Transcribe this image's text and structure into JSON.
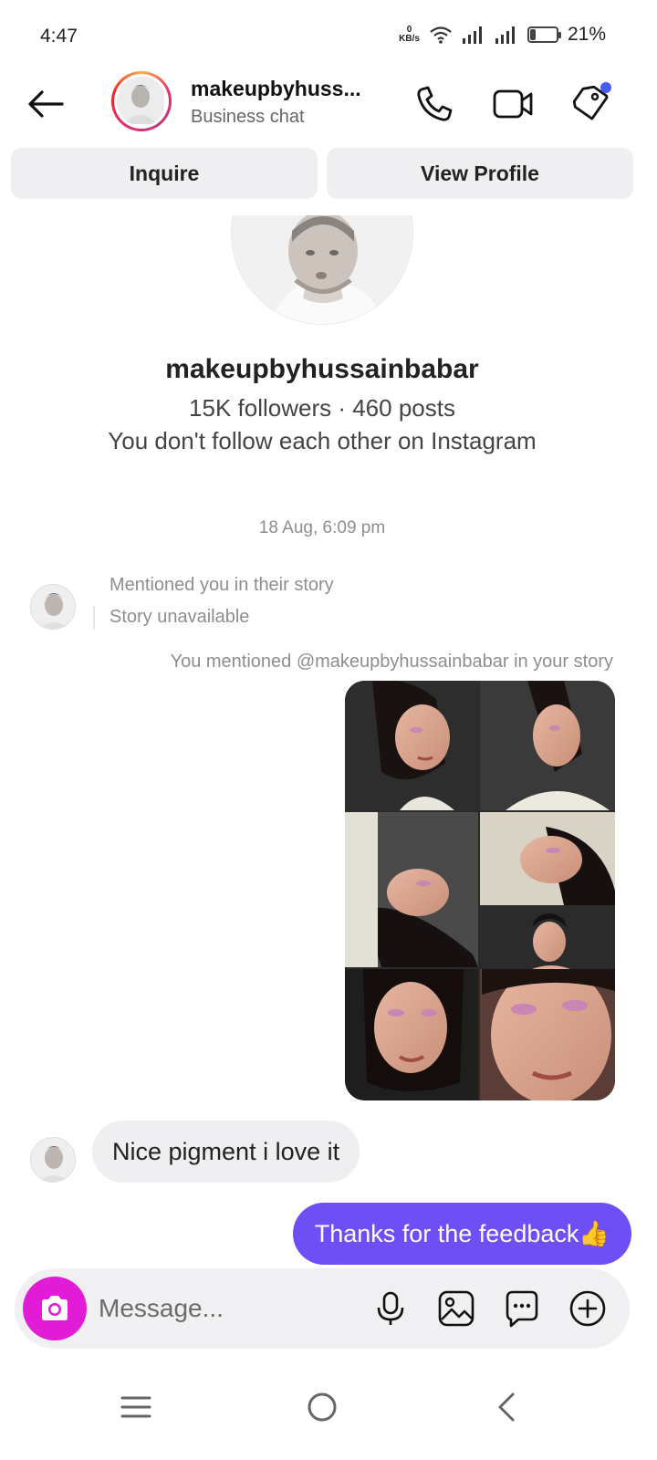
{
  "status_bar": {
    "time": "4:47",
    "net_speed_value": "0",
    "net_speed_unit": "KB/s",
    "battery_percent": "21%",
    "battery_level": 0.21
  },
  "header": {
    "name": "makeupbyhuss...",
    "subtitle": "Business chat",
    "icons": [
      "back-arrow-icon",
      "phone-icon",
      "video-camera-icon",
      "tag-icon"
    ]
  },
  "actions": {
    "inquire_label": "Inquire",
    "view_profile_label": "View Profile"
  },
  "profile": {
    "username": "makeupbyhussainbabar",
    "stats": "15K followers · 460 posts",
    "follow_status": "You don't follow each other on Instagram"
  },
  "conversation": {
    "timestamp": "18 Aug, 6:09 pm",
    "mention_received_line1": "Mentioned you in their story",
    "mention_received_line2": "Story unavailable",
    "mention_sent": "You mentioned @makeupbyhussainbabar in your story",
    "incoming_message": "Nice pigment i love it",
    "outgoing_message": "Thanks for the feedback👍"
  },
  "composer": {
    "placeholder": "Message...",
    "icons": [
      "camera-icon",
      "microphone-icon",
      "gallery-icon",
      "sticker-icon",
      "plus-icon"
    ]
  },
  "colors": {
    "outgoing_bubble": "#6e4ff6",
    "camera_button": "#e11bd6",
    "incoming_bubble": "#efeff1",
    "notification_dot": "#4a5cf0"
  }
}
